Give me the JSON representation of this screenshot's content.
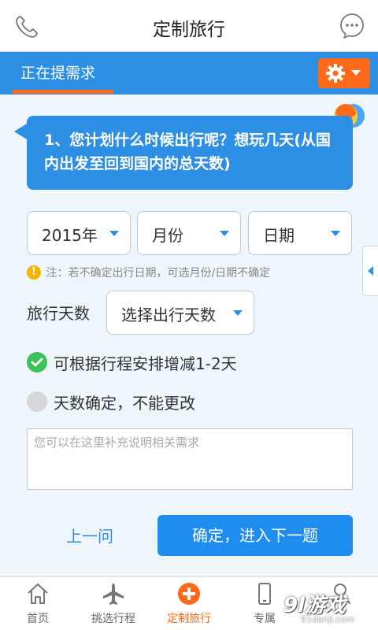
{
  "header": {
    "title": "定制旅行",
    "left_icon": "phone-icon",
    "right_icon": "chat-bubble-icon"
  },
  "tabbar": {
    "active_tab": "正在提需求",
    "settings_icon": "gear-icon"
  },
  "question": {
    "text": "1、您计划什么时候出行呢？想玩几天(从国内出发至回到国内的总天数)"
  },
  "date_select": {
    "year": "2015年",
    "month": "月份",
    "day": "日期"
  },
  "note": {
    "text": "注：若不确定出行日期，可选月份/日期不确定"
  },
  "days": {
    "label": "旅行天数",
    "select": "选择出行天数"
  },
  "options": [
    {
      "label": "可根据行程安排增减1-2天",
      "checked": true
    },
    {
      "label": "天数确定，不能更改",
      "checked": false
    }
  ],
  "remark": {
    "placeholder": "您可以在这里补充说明相关需求",
    "value": ""
  },
  "actions": {
    "prev": "上一问",
    "next": "确定，进入下一题"
  },
  "bottom_nav": [
    {
      "label": "首页",
      "icon": "home-icon"
    },
    {
      "label": "挑选行程",
      "icon": "airplane-icon"
    },
    {
      "label": "定制旅行",
      "icon": "plus-circle-icon",
      "active": true
    },
    {
      "label": "专属",
      "icon": "phone-device-icon"
    },
    {
      "label": "",
      "icon": "user-icon"
    }
  ],
  "watermark": {
    "main": "9l游戏",
    "sub": "91danji.com"
  },
  "colors": {
    "primary_blue": "#2d8fe3",
    "accent_orange": "#ff6a1a",
    "check_green": "#3cc25a"
  }
}
